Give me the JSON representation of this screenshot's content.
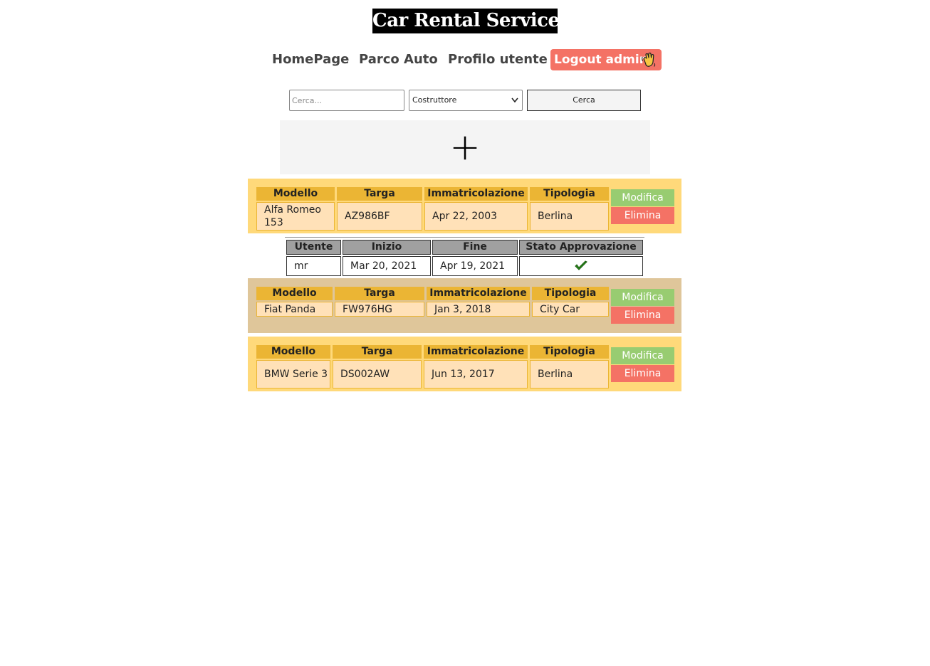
{
  "header": {
    "title": "Car Rental Service"
  },
  "nav": {
    "home": "HomePage",
    "fleet": "Parco Auto",
    "profile": "Profilo utente",
    "logout": "Logout admin",
    "logout_icon": "waving-hand-icon"
  },
  "search": {
    "placeholder": "Cerca...",
    "value": "",
    "select_value": "Costruttore",
    "button": "Cerca"
  },
  "add_button": {
    "symbol": "+",
    "icon": "plus-icon"
  },
  "car_columns": [
    "Modello",
    "Targa",
    "Immatricolazione",
    "Tipologia"
  ],
  "cars": [
    {
      "model": "Alfa Romeo 153",
      "plate": "AZ986BF",
      "registration": "Apr 22, 2003",
      "type": "Berlina",
      "edit": "Modifica",
      "delete": "Elimina",
      "background": "#ffd97a"
    },
    {
      "model": "Fiat Panda",
      "plate": "FW976HG",
      "registration": "Jan 3, 2018",
      "type": "City Car",
      "edit": "Modifica",
      "delete": "Elimina",
      "background": "#dfc69a"
    },
    {
      "model": "BMW Serie 3",
      "plate": "DS002AW",
      "registration": "Jun 13, 2017",
      "type": "Berlina",
      "edit": "Modifica",
      "delete": "Elimina",
      "background": "#ffd97a"
    }
  ],
  "rental_columns": [
    "Utente",
    "Inizio",
    "Fine",
    "Stato Approvazione"
  ],
  "rentals": [
    {
      "user": "mr",
      "start": "Mar 20, 2021",
      "end": "Apr 19, 2021",
      "status_icon": "checkmark-icon"
    }
  ],
  "colors": {
    "header_cell": "#ebb534",
    "value_cell": "#ffe1b8",
    "edit_button": "#98cc71",
    "delete_button": "#f47265",
    "approved": "#2e8b1e"
  }
}
